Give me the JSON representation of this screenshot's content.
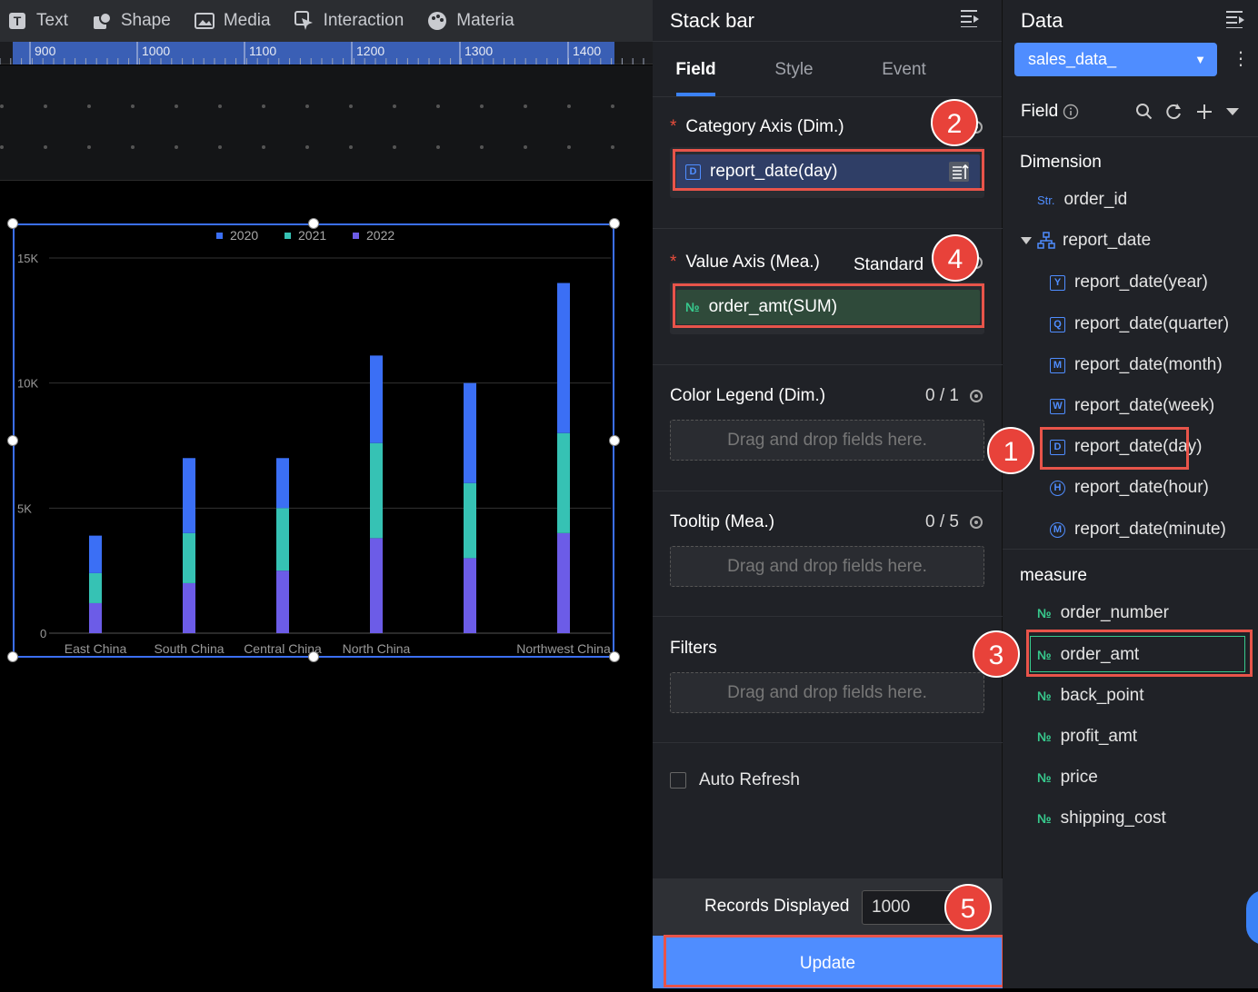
{
  "toolbar": {
    "text_label": "Text",
    "shape_label": "Shape",
    "media_label": "Media",
    "interaction_label": "Interaction",
    "material_label": "Materia"
  },
  "ruler": {
    "ticks": [
      "900",
      "1000",
      "1100",
      "1200",
      "1300",
      "1400"
    ]
  },
  "chart_data": {
    "type": "bar",
    "stacked": true,
    "categories": [
      "East China",
      "South China",
      "Central China",
      "North China",
      "",
      "Northwest China"
    ],
    "series": [
      {
        "name": "2020",
        "color": "#3b6ff5",
        "values": [
          1500,
          3000,
          2000,
          3500,
          4000,
          6000
        ]
      },
      {
        "name": "2021",
        "color": "#36c2b4",
        "values": [
          1200,
          2000,
          2500,
          3800,
          3000,
          4000
        ]
      },
      {
        "name": "2022",
        "color": "#6c5ce7",
        "values": [
          1200,
          2000,
          2500,
          3800,
          3000,
          4000
        ]
      }
    ],
    "y_ticks": [
      "15K",
      "10K",
      "5K",
      "0"
    ],
    "ylim": [
      0,
      15000
    ],
    "legend": "top-center",
    "grid": true
  },
  "config": {
    "title": "Stack bar",
    "tabs": [
      "Field",
      "Style",
      "Event"
    ],
    "category_axis": {
      "title": "Category Axis (Dim.)",
      "field": "report_date(day)",
      "field_icon": "D",
      "badge": "2"
    },
    "value_axis": {
      "title": "Value Axis (Mea.)",
      "mode": "Standard",
      "field": "order_amt(SUM)",
      "field_icon": "№",
      "badge": "4"
    },
    "color_legend": {
      "title": "Color Legend (Dim.)",
      "count": "0 / 1",
      "placeholder": "Drag and drop fields here."
    },
    "tooltip": {
      "title": "Tooltip (Mea.)",
      "count": "0 / 5",
      "placeholder": "Drag and drop fields here."
    },
    "filters": {
      "title": "Filters",
      "placeholder": "Drag and drop fields here."
    },
    "auto_refresh": {
      "label": "Auto Refresh",
      "checked": false
    },
    "records": {
      "label": "Records Displayed",
      "value": "1000",
      "badge": "5"
    },
    "update_label": "Update"
  },
  "data_panel": {
    "title": "Data",
    "dataset": "sales_data_",
    "field_label": "Field",
    "dimension_label": "Dimension",
    "dimension_items": [
      {
        "icon": "Str.",
        "label": "order_id"
      },
      {
        "icon": "hierarchy",
        "label": "report_date"
      },
      {
        "icon": "Y",
        "label": "report_date(year)"
      },
      {
        "icon": "Q",
        "label": "report_date(quarter)"
      },
      {
        "icon": "M",
        "label": "report_date(month)"
      },
      {
        "icon": "W",
        "label": "report_date(week)"
      },
      {
        "icon": "D",
        "label": "report_date(day)"
      },
      {
        "icon": "H",
        "label": "report_date(hour)"
      },
      {
        "icon": "M",
        "label": "report_date(minute)"
      }
    ],
    "measure_label": "measure",
    "measure_items": [
      {
        "icon": "№",
        "label": "order_number"
      },
      {
        "icon": "№",
        "label": "order_amt"
      },
      {
        "icon": "№",
        "label": "back_point"
      },
      {
        "icon": "№",
        "label": "profit_amt"
      },
      {
        "icon": "№",
        "label": "price"
      },
      {
        "icon": "№",
        "label": "shipping_cost"
      }
    ],
    "badges": {
      "day": "1",
      "order_amt": "3"
    }
  }
}
